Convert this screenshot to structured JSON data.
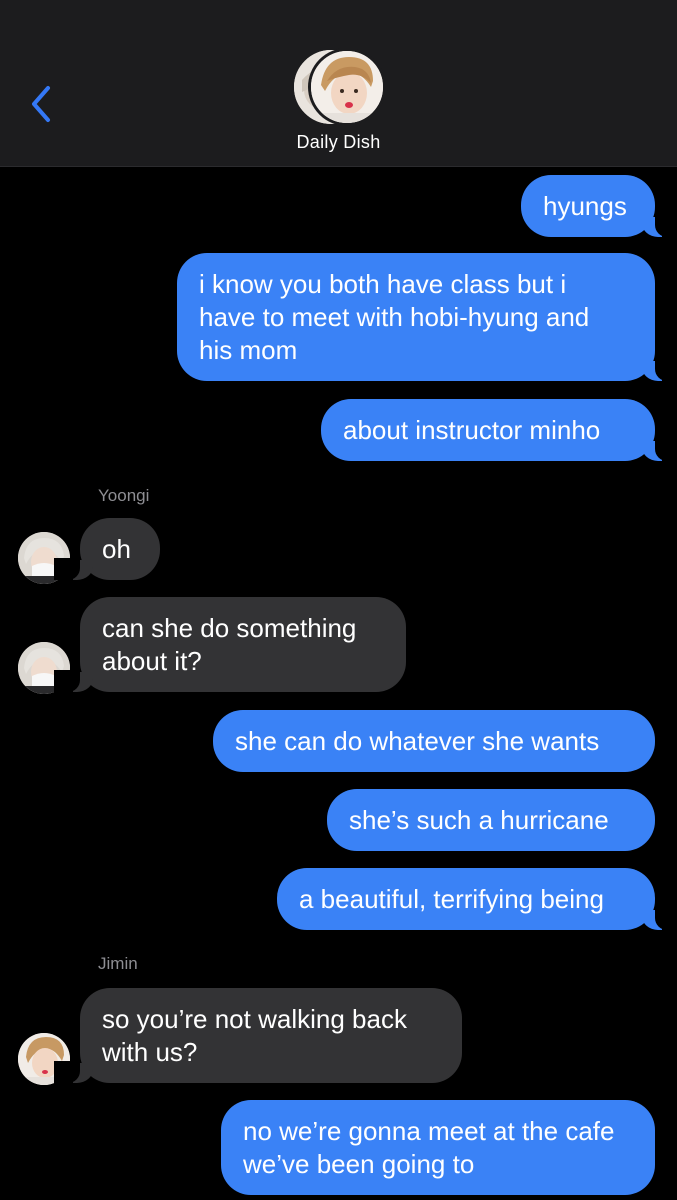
{
  "header": {
    "title": "Daily Dish"
  },
  "messages": [
    {
      "text": "hyungs"
    },
    {
      "text": "i know you both have class but i\nhave to meet with hobi-hyung and\nhis mom"
    },
    {
      "text": "about instructor minho"
    },
    {
      "text": "oh"
    },
    {
      "text": "can she do something\nabout it?"
    },
    {
      "text": "she can do whatever she wants"
    },
    {
      "text": "she’s such a hurricane"
    },
    {
      "text": "a beautiful, terrifying being"
    },
    {
      "text": "so you’re not walking back\nwith us?"
    },
    {
      "text": "no we’re gonna meet at the cafe\nwe’ve been going to"
    }
  ],
  "senders": {
    "yoongi": "Yoongi",
    "jimin": "Jimin"
  },
  "colors": {
    "outgoing": "#3a82f6",
    "incoming": "#333335",
    "header_bg": "#1c1c1e",
    "accent": "#3478f6"
  },
  "icons": {
    "back": "chevron-left-icon"
  }
}
